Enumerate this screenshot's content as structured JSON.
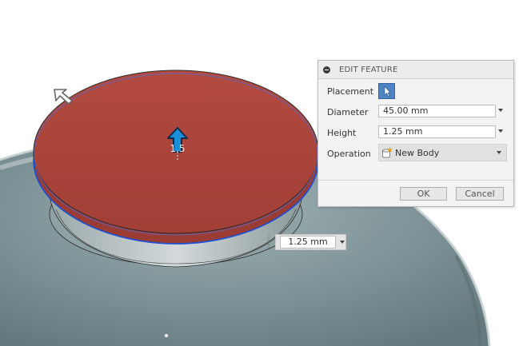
{
  "viewport": {
    "manipulator_label": "1.5",
    "dimension_input_value": "1.25 mm"
  },
  "panel": {
    "title": "EDIT FEATURE",
    "placement_label": "Placement",
    "diameter_label": "Diameter",
    "diameter_value": "45.00 mm",
    "height_label": "Height",
    "height_value": "1.25 mm",
    "operation_label": "Operation",
    "operation_value": "New Body",
    "ok_label": "OK",
    "cancel_label": "Cancel"
  },
  "icons": {
    "collapse": "collapse-icon",
    "select": "select-arrow-icon",
    "new_body": "new-body-icon",
    "pan_cursor": "arrow-cursor-icon",
    "move_arrow": "move-arrow-icon"
  },
  "colors": {
    "cylinder_top": "#a6443c",
    "body": "#7c9296",
    "edge_highlight": "#1f4fd0",
    "accent": "#4f84c2"
  }
}
